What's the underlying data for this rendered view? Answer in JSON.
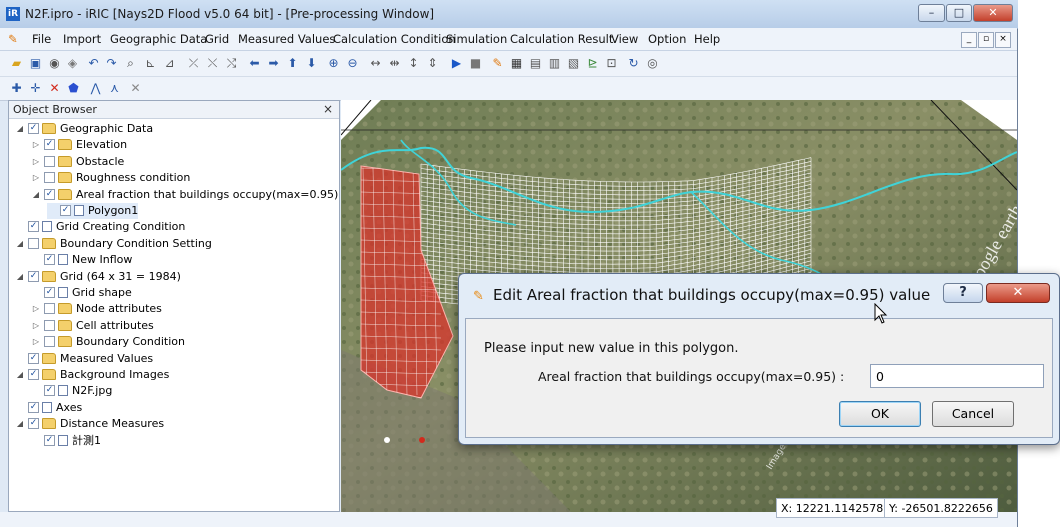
{
  "window": {
    "title": "N2F.ipro - iRIC [Nays2D Flood v5.0 64 bit] - [Pre-processing Window]",
    "app_icon_text": "iR",
    "buttons": {
      "minimize": "–",
      "maximize": "□",
      "close": "✕"
    }
  },
  "menubar": {
    "items": [
      "File",
      "Import",
      "Geographic Data",
      "Grid",
      "Measured Values",
      "Calculation Condition",
      "Simulation",
      "Calculation Result",
      "View",
      "Option",
      "Help"
    ]
  },
  "object_browser": {
    "title": "Object Browser",
    "close": "×",
    "tree": [
      {
        "label": "Geographic Data",
        "expander": "◢",
        "checked": true,
        "icon": "folder-icon"
      },
      {
        "label": "Elevation",
        "expander": "▷",
        "checked": true,
        "icon": "folder-icon"
      },
      {
        "label": "Obstacle",
        "expander": "▷",
        "checked": false,
        "icon": "folder-icon"
      },
      {
        "label": "Roughness condition",
        "expander": "▷",
        "checked": false,
        "icon": "folder-icon"
      },
      {
        "label": "Areal fraction that buildings occupy(max=0.95)",
        "expander": "◢",
        "checked": true,
        "icon": "folder-icon"
      },
      {
        "label": "Polygon1",
        "expander": "",
        "checked": true,
        "icon": "document-icon"
      },
      {
        "label": "Grid Creating Condition",
        "expander": "",
        "checked": true,
        "icon": "document-icon"
      },
      {
        "label": "Boundary Condition Setting",
        "expander": "◢",
        "checked": false,
        "icon": "folder-icon"
      },
      {
        "label": "New Inflow",
        "expander": "",
        "checked": true,
        "icon": "document-icon"
      },
      {
        "label": "Grid (64 x 31 = 1984)",
        "expander": "◢",
        "checked": true,
        "icon": "folder-icon"
      },
      {
        "label": "Grid shape",
        "expander": "",
        "checked": true,
        "icon": "document-icon"
      },
      {
        "label": "Node attributes",
        "expander": "▷",
        "checked": false,
        "icon": "folder-icon"
      },
      {
        "label": "Cell attributes",
        "expander": "▷",
        "checked": false,
        "icon": "folder-icon"
      },
      {
        "label": "Boundary Condition",
        "expander": "▷",
        "checked": false,
        "icon": "folder-icon"
      },
      {
        "label": "Measured Values",
        "expander": "",
        "checked": true,
        "icon": "folder-icon"
      },
      {
        "label": "Background Images",
        "expander": "◢",
        "checked": true,
        "icon": "folder-icon"
      },
      {
        "label": "N2F.jpg",
        "expander": "",
        "checked": true,
        "icon": "document-icon"
      },
      {
        "label": "Axes",
        "expander": "",
        "checked": true,
        "icon": "document-icon"
      },
      {
        "label": "Distance Measures",
        "expander": "◢",
        "checked": true,
        "icon": "folder-icon"
      },
      {
        "label": "計測1",
        "expander": "",
        "checked": true,
        "icon": "document-icon"
      }
    ]
  },
  "map": {
    "watermark": "Google earth",
    "imagery_credit": "Image © 2011"
  },
  "status": {
    "x": "X: 12221.1142578",
    "y": "Y: -26501.8222656"
  },
  "dialog": {
    "title": "Edit Areal fraction that buildings occupy(max=0.95) value",
    "help": "?",
    "close": "✕",
    "message": "Please input new value in this polygon.",
    "field_label": "Areal fraction that buildings occupy(max=0.95) :",
    "field_value": "0",
    "ok": "OK",
    "cancel": "Cancel"
  },
  "colors": {
    "polygon_fill": "#d9332b",
    "river": "#3fd3d8",
    "grid_lines": "#ffffff"
  }
}
